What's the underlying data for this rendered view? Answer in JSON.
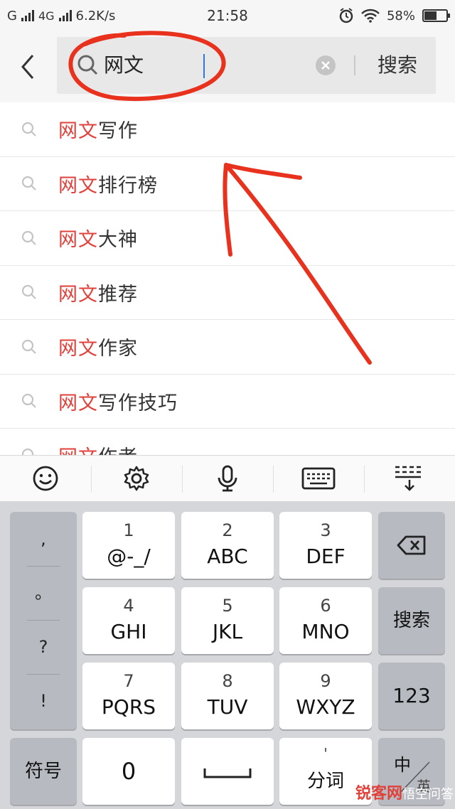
{
  "status_bar": {
    "carrier1": "G",
    "carrier2": "4G",
    "speed": "6.2K/s",
    "time": "21:58",
    "battery": "58%",
    "battery_level": 0.58
  },
  "search": {
    "query": "网文",
    "button_label": "搜索"
  },
  "suggestions": [
    {
      "highlight": "网文",
      "rest": "写作"
    },
    {
      "highlight": "网文",
      "rest": "排行榜"
    },
    {
      "highlight": "网文",
      "rest": "大神"
    },
    {
      "highlight": "网文",
      "rest": "推荐"
    },
    {
      "highlight": "网文",
      "rest": "作家"
    },
    {
      "highlight": "网文",
      "rest": "写作技巧"
    },
    {
      "highlight": "网文",
      "rest": "作者"
    }
  ],
  "keyboard": {
    "punct": [
      ",",
      "。",
      "?",
      "!"
    ],
    "keys": [
      {
        "num": "1",
        "letters": "@-_/"
      },
      {
        "num": "2",
        "letters": "ABC"
      },
      {
        "num": "3",
        "letters": "DEF"
      },
      {
        "num": "4",
        "letters": "GHI"
      },
      {
        "num": "5",
        "letters": "JKL"
      },
      {
        "num": "6",
        "letters": "MNO"
      },
      {
        "num": "7",
        "letters": "PQRS"
      },
      {
        "num": "8",
        "letters": "TUV"
      },
      {
        "num": "9",
        "letters": "WXYZ"
      }
    ],
    "search_key": "搜索",
    "num_key": "123",
    "symbol_key": "符号",
    "zero_key": "0",
    "fenci_top": "'",
    "fenci_key": "分词",
    "lang_key": "中",
    "lang_sub": "英"
  },
  "watermark": {
    "brand": "锐客网",
    "sub": "悟空问答"
  },
  "colors": {
    "highlight": "#e0413a",
    "annotation": "#e8321e"
  }
}
